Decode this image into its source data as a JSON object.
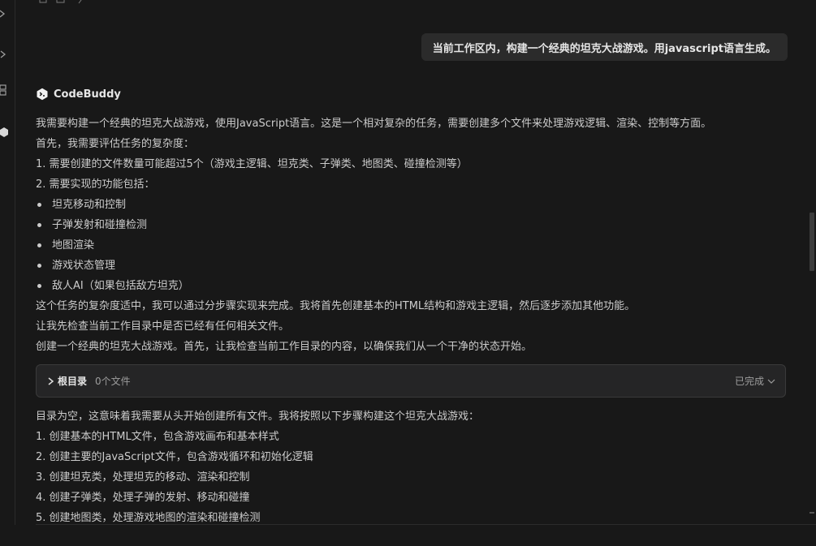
{
  "user_message": "当前工作区内，构建一个经典的坦克大战游戏。用javascript语言生成。",
  "assistant": {
    "name": "CodeBuddy",
    "logo_icon": "codebuddy-logo-icon"
  },
  "paragraphs_top": [
    "我需要构建一个经典的坦克大战游戏，使用JavaScript语言。这是一个相对复杂的任务，需要创建多个文件来处理游戏逻辑、渲染、控制等方面。",
    "首先，我需要评估任务的复杂度：",
    "1. 需要创建的文件数量可能超过5个（游戏主逻辑、坦克类、子弹类、地图类、碰撞检测等）",
    "2. 需要实现的功能包括："
  ],
  "bullets": [
    "坦克移动和控制",
    "子弹发射和碰撞检测",
    "地图渲染",
    "游戏状态管理",
    "敌人AI（如果包括敌方坦克）"
  ],
  "paragraphs_mid": [
    "这个任务的复杂度适中，我可以通过分步骤实现来完成。我将首先创建基本的HTML结构和游戏主逻辑，然后逐步添加其他功能。",
    "让我先检查当前工作目录中是否已经有任何相关文件。",
    "创建一个经典的坦克大战游戏。首先，让我检查当前工作目录的内容，以确保我们从一个干净的状态开始。"
  ],
  "tool_card": {
    "title": "根目录",
    "count": "0个文件",
    "status": "已完成"
  },
  "paragraphs_bottom": [
    "目录为空，这意味着我需要从头开始创建所有文件。我将按照以下步骤构建这个坦克大战游戏：",
    "1. 创建基本的HTML文件，包含游戏画布和基本样式",
    "2. 创建主要的JavaScript文件，包含游戏循环和初始化逻辑",
    "3. 创建坦克类，处理坦克的移动、渲染和控制",
    "4. 创建子弹类，处理子弹的发射、移动和碰撞",
    "5. 创建地图类，处理游戏地图的渲染和碰撞检测"
  ],
  "colors": {
    "background": "#181818",
    "bubble": "#2b2b2b",
    "card": "#252526",
    "text": "#cccccc"
  }
}
